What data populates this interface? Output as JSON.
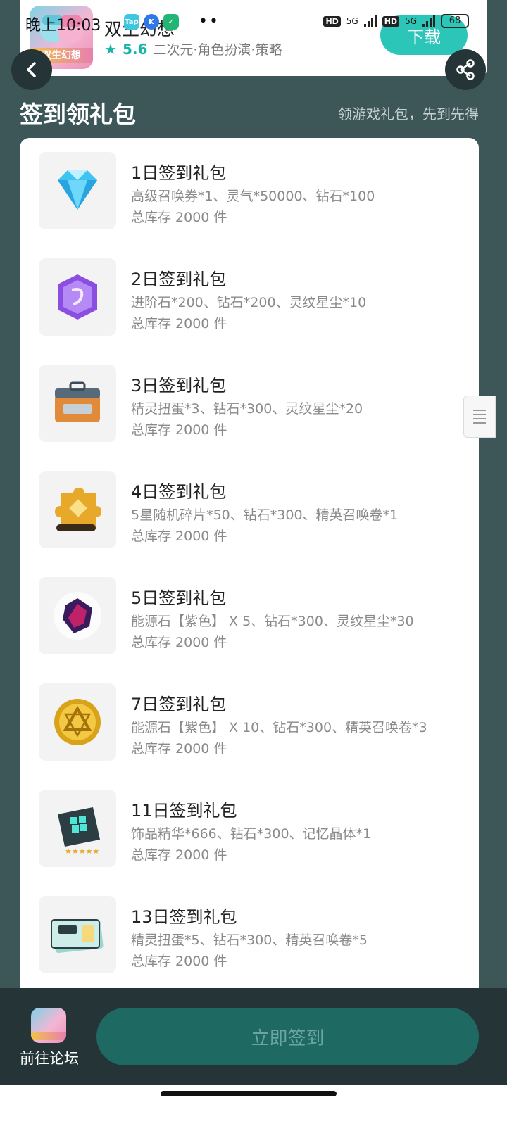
{
  "status_bar": {
    "time": "晚上10:03",
    "app_badges": [
      "Tap",
      "K",
      "✓"
    ],
    "dots": "••",
    "network": "5G",
    "battery": "68"
  },
  "app": {
    "name": "双生幻想",
    "logo_text": "双生幻想",
    "rating": "5.6",
    "tags": "二次元·角色扮演·策略",
    "download_label": "下载"
  },
  "section": {
    "title": "签到领礼包",
    "subtitle": "领游戏礼包，先到先得"
  },
  "gifts": [
    {
      "title": "1日签到礼包",
      "desc": "高级召唤券*1、灵气*50000、钻石*100",
      "stock": "总库存 2000 件",
      "icon": "diamond-icon"
    },
    {
      "title": "2日签到礼包",
      "desc": "进阶石*200、钻石*200、灵纹星尘*10",
      "stock": "总库存 2000 件",
      "icon": "purple-gem-icon"
    },
    {
      "title": "3日签到礼包",
      "desc": "精灵扭蛋*3、钻石*300、灵纹星尘*20",
      "stock": "总库存 2000 件",
      "icon": "chest-icon"
    },
    {
      "title": "4日签到礼包",
      "desc": "5星随机碎片*50、钻石*300、精英召唤卷*1",
      "stock": "总库存 2000 件",
      "icon": "puzzle-piece-icon"
    },
    {
      "title": "5日签到礼包",
      "desc": "能源石【紫色】 X 5、钻石*300、灵纹星尘*30",
      "stock": "总库存 2000 件",
      "icon": "energy-stone-icon"
    },
    {
      "title": "7日签到礼包",
      "desc": "能源石【紫色】 X 10、钻石*300、精英召唤卷*3",
      "stock": "总库存 2000 件",
      "icon": "gold-coin-icon"
    },
    {
      "title": "11日签到礼包",
      "desc": "饰品精华*666、钻石*300、记忆晶体*1",
      "stock": "总库存 2000 件",
      "icon": "accessory-essence-icon"
    },
    {
      "title": "13日签到礼包",
      "desc": "精灵扭蛋*5、钻石*300、精英召唤卷*5",
      "stock": "总库存 2000 件",
      "icon": "summon-ticket-icon"
    }
  ],
  "bottom": {
    "forum_label": "前往论坛",
    "sign_label": "立即签到"
  },
  "colors": {
    "accent": "#2cc6b8",
    "page_bg": "#3d5759",
    "bottom_bar": "#253436",
    "sign_button": "#1e6a63"
  }
}
